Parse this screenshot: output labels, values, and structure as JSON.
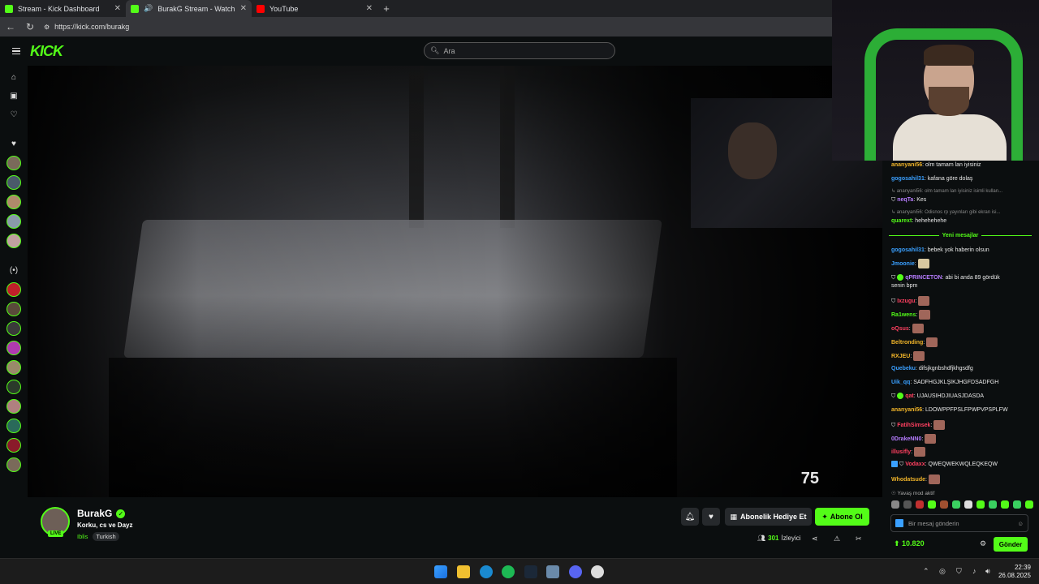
{
  "browser": {
    "tabs": [
      {
        "title": "Stream - Kick Dashboard",
        "favicon_color": "#53fc18",
        "active": false
      },
      {
        "title": "BurakG Stream - Watch Live",
        "favicon_color": "#53fc18",
        "active": true
      },
      {
        "title": "YouTube",
        "favicon_color": "#ff0000",
        "active": false
      }
    ],
    "new_tab": "+",
    "url": "https://kick.com/burakg"
  },
  "header": {
    "logo": "KICK",
    "search_placeholder": "Ara"
  },
  "video": {
    "overlay_counter": "75"
  },
  "stream": {
    "streamer": "BurakG",
    "live_badge": "LIVE",
    "title": "Korku, cs ve Dayz",
    "category": "Iblis",
    "tag": "Turkish",
    "gift_label": "Abonelik Hediye Et",
    "subscribe_label": "Abone Ol",
    "viewer_count": "301",
    "viewer_label": "İzleyici"
  },
  "chat": {
    "messages": [
      {
        "user": "ananyani56",
        "color": "#f0b429",
        "text": "olm tamam lan iyisiniz",
        "reply": ""
      },
      {
        "user": "gogosahil31",
        "color": "#3aa0ff",
        "text": "kafana göre dolaş",
        "reply": ""
      },
      {
        "user": "neqTa",
        "color": "#b67cff",
        "text": "Kes",
        "reply": "ananyani56: olm tamam lan iyisiniz isimli kullan..."
      },
      {
        "user": "quarext",
        "color": "#53fc18",
        "text": "hehehehehe",
        "reply": "ananyani56: Odisnos rp yayınları gibi ekran isi..."
      }
    ],
    "divider_label": "Yeni mesajlar",
    "messages2": [
      {
        "user": "gogosahil31",
        "color": "#3aa0ff",
        "text": "bebek yok haberin olsun"
      },
      {
        "user": "Jmoonie",
        "color": "#3aa0ff",
        "text": ""
      },
      {
        "user": "qPRINCETON",
        "color": "#b67cff",
        "text": "abi bi anda 89 gördük"
      },
      {
        "user": "",
        "color": "#e8e8e8",
        "text": "senin bpm"
      },
      {
        "user": "Ixzugu",
        "color": "#ff4060",
        "text": ""
      },
      {
        "user": "Ra1wens",
        "color": "#53fc18",
        "text": ""
      },
      {
        "user": "oQsus",
        "color": "#ff4060",
        "text": ""
      },
      {
        "user": "Beltronding",
        "color": "#f0b429",
        "text": ""
      },
      {
        "user": "RXJEU",
        "color": "#f0b429",
        "text": ""
      },
      {
        "user": "Quebeku",
        "color": "#3aa0ff",
        "text": "difsjkgnbshdfjkhgsdfg"
      },
      {
        "user": "Uik_qq",
        "color": "#3aa0ff",
        "text": "SADFHGJKLŞİKJHGFDSADFGH"
      },
      {
        "user": "qat",
        "color": "#ff4060",
        "text": "UJAUSIHDJIUASJDASDA"
      },
      {
        "user": "ananyani56",
        "color": "#f0b429",
        "text": "LDOWPPFPSLFPWPVPSPLFW"
      },
      {
        "user": "FatihSimsek",
        "color": "#ff4060",
        "text": ""
      },
      {
        "user": "0DrakeNN0",
        "color": "#b67cff",
        "text": ""
      },
      {
        "user": "illusifly",
        "color": "#ff4060",
        "text": ""
      },
      {
        "user": "Vodaxx",
        "color": "#ff4060",
        "text": "QWEQWEKWQLEQKEQW"
      },
      {
        "user": "Whodatsude",
        "color": "#f0b429",
        "text": ""
      }
    ],
    "slow_mode": "Yavaş mod aktif",
    "input_placeholder": "Bir mesaj gönderin",
    "points": "10.820",
    "send_label": "Gönder"
  },
  "taskbar": {
    "time": "22:39",
    "date": "26.08.2025"
  }
}
